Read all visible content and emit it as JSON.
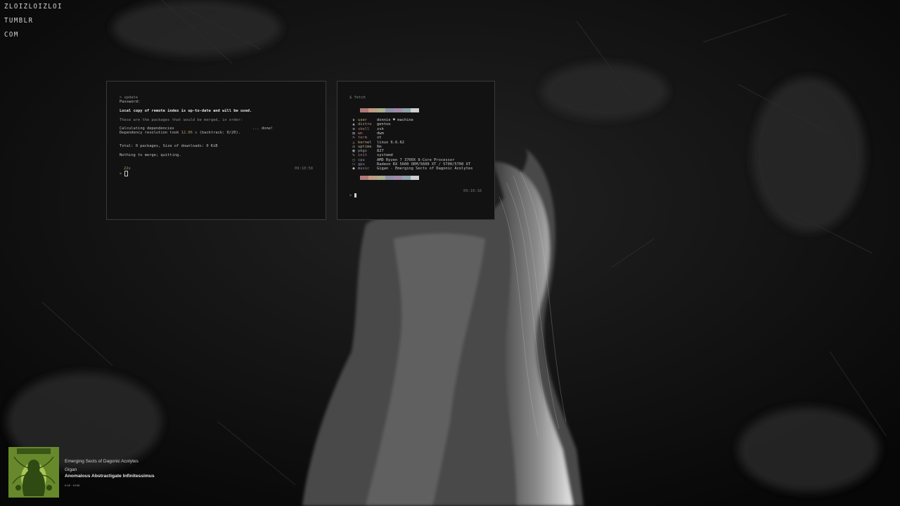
{
  "desktop": {
    "corner_lines": [
      "ZLOIZLOIZLOI",
      "TUMBLR",
      "COM"
    ]
  },
  "term_left": {
    "prompt_cmd": "> update",
    "password_label": "Password:",
    "index_msg": "Local copy of remote index is up-to-date and will be used.",
    "merge_header": "These are the packages that would be merged, in order:",
    "calc_deps": "Calculating dependencies",
    "calc_done": "... done!",
    "dep_res_pre": "Dependency resolution took ",
    "dep_res_time": "12.06 s",
    "dep_res_post": " (backtrack: 0/20).",
    "total": "Total: 0 packages, Size of downloads: 0 KiB",
    "nothing": "Nothing to merge; quitting.",
    "duration": "22s",
    "prompt_symbol": ">",
    "timestamp": "09:10:58"
  },
  "term_right": {
    "prompt_cmd": "$ fetch",
    "rows": [
      {
        "icon": "♛",
        "key": "user",
        "val": "donnie ♥ machine"
      },
      {
        "icon": "▲",
        "key": "distro",
        "val": "gentoo"
      },
      {
        "icon": "⚙",
        "key": "shell",
        "val": "zsh"
      },
      {
        "icon": "▤",
        "key": "wm",
        "val": "dwm"
      },
      {
        "icon": ">",
        "key": "term",
        "val": "st"
      },
      {
        "icon": "△",
        "key": "kernel",
        "val": "linux 6.6.62"
      },
      {
        "icon": "◷",
        "key": "uptime",
        "val": "6m"
      },
      {
        "icon": "▦",
        "key": "pkgs",
        "val": "827"
      },
      {
        "icon": "✎",
        "key": "init",
        "val": "systemd"
      },
      {
        "icon": "▢",
        "key": "cpu",
        "val": "AMD Ryzen 7 3700X 8-Core Processor"
      },
      {
        "icon": "▭",
        "key": "gpu",
        "val": "Radeon RX 5600 OEM/5600 XT / 5700/5700 XT"
      },
      {
        "icon": "●",
        "key": "music",
        "val": "Gigan - Emerging Sects of Dagonic Acolytes"
      }
    ],
    "swatch_colors": [
      "#b07a78",
      "#c49a83",
      "#a9ae8c",
      "#8b8fa8",
      "#a48aa6",
      "#8ea3ad",
      "#cfcfcf"
    ],
    "timestamp": "09:10:16",
    "prompt_symbol": ">"
  },
  "music": {
    "album": "Emerging Sects of Dagonic Acolytes",
    "artist": "Gigan",
    "track": "Anomalous Abstractigate Infinitessimus",
    "time": "0:18 · 10:06",
    "art_colors": {
      "bg": "#7aa233",
      "fg": "#2f4a12",
      "glow": "#c8e06a"
    }
  }
}
